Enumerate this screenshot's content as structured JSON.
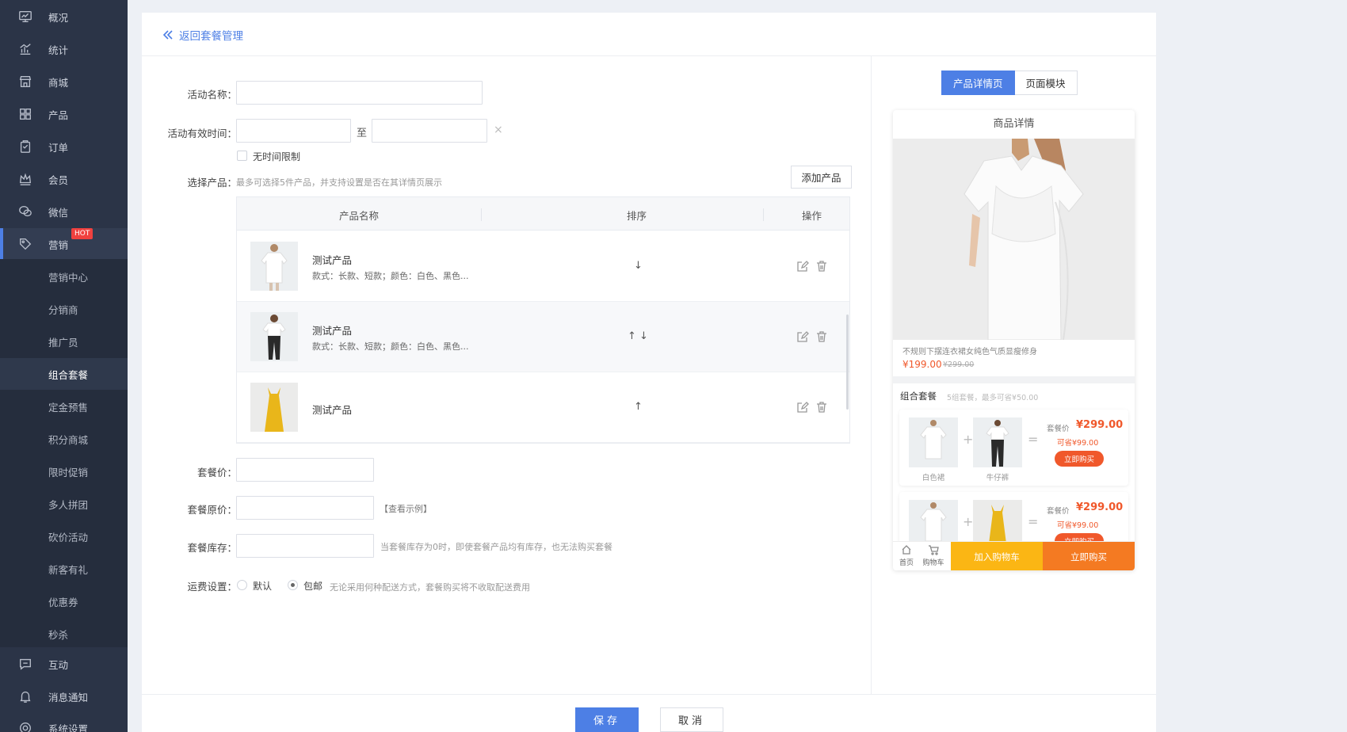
{
  "sidebar": {
    "items": [
      {
        "label": "概况",
        "icon": "monitor-icon"
      },
      {
        "label": "统计",
        "icon": "chart-icon"
      },
      {
        "label": "商城",
        "icon": "store-icon"
      },
      {
        "label": "产品",
        "icon": "grid-icon"
      },
      {
        "label": "订单",
        "icon": "clipboard-icon"
      },
      {
        "label": "会员",
        "icon": "crown-icon"
      },
      {
        "label": "微信",
        "icon": "wechat-icon"
      },
      {
        "label": "营销",
        "icon": "tag-icon",
        "badge": "HOT"
      },
      {
        "label": "互动",
        "icon": "message-icon"
      },
      {
        "label": "消息通知",
        "icon": "bell-icon"
      },
      {
        "label": "系统设置",
        "icon": "settings-icon"
      }
    ],
    "submenu": [
      "营销中心",
      "分销商",
      "推广员",
      "组合套餐",
      "定金预售",
      "积分商城",
      "限时促销",
      "多人拼团",
      "砍价活动",
      "新客有礼",
      "优惠券",
      "秒杀"
    ]
  },
  "header": {
    "back_label": "返回套餐管理"
  },
  "form": {
    "name_label": "活动名称：",
    "time_label": "活动有效时间：",
    "time_sep": "至",
    "clear_symbol": "×",
    "no_limit_label": "无时间限制",
    "product_label": "选择产品：",
    "product_hint": "最多可选择5件产品，并支持设置是否在其详情页展示",
    "add_product": "添加产品",
    "table_headers": {
      "name": "产品名称",
      "sort": "排序",
      "ops": "操作"
    },
    "products": [
      {
        "name": "测试产品",
        "spec": "款式：长款、短款；颜色：白色、黑色...",
        "sort": "↓"
      },
      {
        "name": "测试产品",
        "spec": "款式：长款、短款；颜色：白色、黑色...",
        "sort": "↑ ↓"
      },
      {
        "name": "测试产品",
        "spec": "",
        "sort": "↑"
      }
    ],
    "price_label": "套餐价：",
    "orig_price_label": "套餐原价：",
    "view_example": "【查看示例】",
    "stock_label": "套餐库存：",
    "stock_hint": "当套餐库存为0时，即使套餐产品均有库存，也无法购买套餐",
    "shipping_label": "运费设置：",
    "shipping_default": "默认",
    "shipping_free": "包邮",
    "shipping_hint": "无论采用何种配送方式，套餐购买将不收取配送费用"
  },
  "preview": {
    "tabs": [
      "产品详情页",
      "页面模块"
    ],
    "title": "商品详情",
    "product_desc": "不规则下摆连衣裙女纯色气质显瘦修身",
    "product_price": "¥199.00",
    "product_orig": "¥299.00",
    "combo_title": "组合套餐",
    "combo_sub": "5组套餐，最多可省¥50.00",
    "combos": [
      {
        "cap1": "白色裙",
        "cap2": "牛仔裤",
        "price_label": "套餐价",
        "price": "¥299.00",
        "save": "可省¥99.00",
        "buy": "立即购买"
      },
      {
        "cap1": "",
        "cap2": "",
        "price_label": "套餐价",
        "price": "¥299.00",
        "save": "可省¥99.00",
        "buy": "立即购买"
      }
    ],
    "bar": {
      "home": "首页",
      "cart": "购物车",
      "add_cart": "加入购物车",
      "buy_now": "立即购买"
    }
  },
  "footer": {
    "save": "保存",
    "cancel": "取消"
  },
  "colors": {
    "accent": "#4d7fe5",
    "sidebar": "#2b3447",
    "price": "#f0582b",
    "cart": "#fbb614",
    "buy": "#f47a22"
  }
}
